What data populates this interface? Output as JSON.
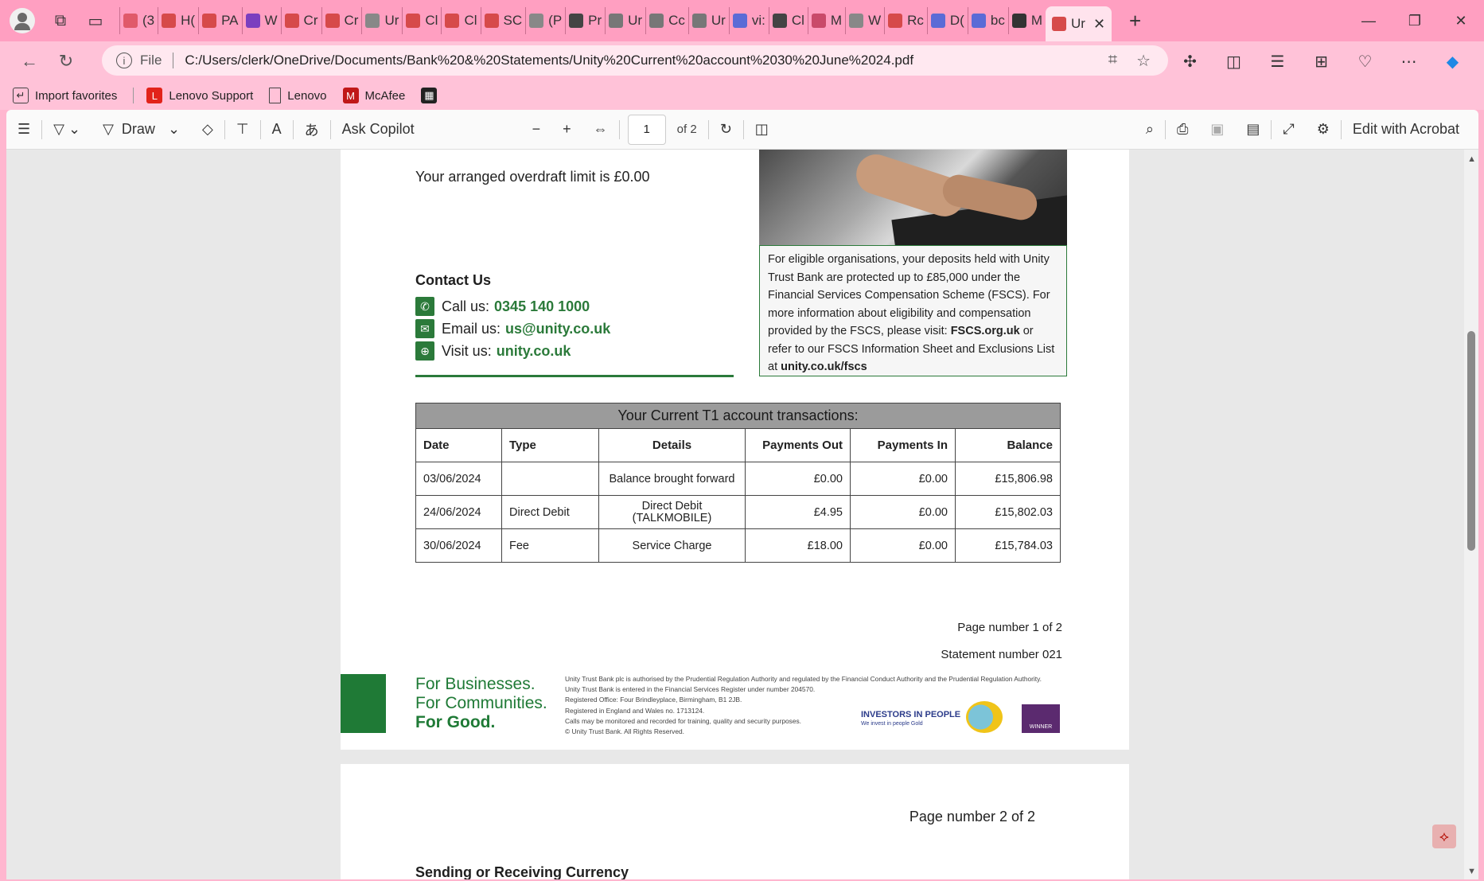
{
  "browser": {
    "tabs": [
      {
        "label": "(3",
        "color": "#e05a6a"
      },
      {
        "label": "H(",
        "color": "#d64a4a"
      },
      {
        "label": "PA",
        "color": "#d64a4a"
      },
      {
        "label": "W",
        "color": "#7b3fbf"
      },
      {
        "label": "Cr",
        "color": "#d64a4a"
      },
      {
        "label": "Cr",
        "color": "#d64a4a"
      },
      {
        "label": "Ur",
        "color": "#888888"
      },
      {
        "label": "Cl",
        "color": "#d64a4a"
      },
      {
        "label": "Cl",
        "color": "#d64a4a"
      },
      {
        "label": "SC",
        "color": "#d64a4a"
      },
      {
        "label": "(P",
        "color": "#888888"
      },
      {
        "label": "Pr",
        "color": "#444444"
      },
      {
        "label": "Ur",
        "color": "#777777"
      },
      {
        "label": "Cc",
        "color": "#777777"
      },
      {
        "label": "Ur",
        "color": "#777777"
      },
      {
        "label": "vi:",
        "color": "#5b6bd6"
      },
      {
        "label": "Cl",
        "color": "#444444"
      },
      {
        "label": "M",
        "color": "#c94a6a"
      },
      {
        "label": "W",
        "color": "#888888"
      },
      {
        "label": "Rc",
        "color": "#d64a4a"
      },
      {
        "label": "D(",
        "color": "#5b6bd6"
      },
      {
        "label": "bc",
        "color": "#5b6bd6"
      },
      {
        "label": "M",
        "color": "#333333"
      }
    ],
    "active_tab": {
      "label": "Ur",
      "close": "✕"
    },
    "new_tab": "+",
    "address": {
      "scheme_label": "File",
      "url": "C:/Users/clerk/OneDrive/Documents/Bank%20&%20Statements/Unity%20Current%20account%2030%20June%2024.pdf"
    },
    "bookmarks": [
      {
        "label": "Import favorites",
        "icon": "import-icon"
      },
      {
        "label": "Lenovo Support",
        "icon": "lenovo-icon",
        "color": "#e2231a"
      },
      {
        "label": "Lenovo",
        "icon": "page-icon"
      },
      {
        "label": "McAfee",
        "icon": "mcafee-icon",
        "color": "#c01818"
      }
    ]
  },
  "pdf_toolbar": {
    "draw_label": "Draw",
    "copilot_label": "Ask Copilot",
    "page_current": "1",
    "page_total": "of 2",
    "edit_label": "Edit with Acrobat"
  },
  "page1": {
    "overdraft": "Your arranged overdraft limit is £0.00",
    "fscs_text_1": "For eligible organisations, your deposits held with Unity Trust Bank are protected up to £85,000 under the Financial Services Compensation Scheme (FSCS). For more information about eligibility and compensation provided by the FSCS, please visit: ",
    "fscs_link_1": "FSCS.org.uk",
    "fscs_text_2": " or refer to our FSCS Information Sheet and Exclusions List at ",
    "fscs_link_2": "unity.co.uk/fscs",
    "contact": {
      "title": "Contact Us",
      "call_label": "Call us:",
      "call_value": "0345 140 1000",
      "email_label": "Email us:",
      "email_value": "us@unity.co.uk",
      "visit_label": "Visit us:",
      "visit_value": "unity.co.uk"
    },
    "table": {
      "caption": "Your Current T1 account transactions:",
      "headers": [
        "Date",
        "Type",
        "Details",
        "Payments Out",
        "Payments In",
        "Balance"
      ],
      "rows": [
        [
          "03/06/2024",
          "",
          "Balance brought forward",
          "£0.00",
          "£0.00",
          "£15,806.98"
        ],
        [
          "24/06/2024",
          "Direct Debit",
          "Direct Debit (TALKMOBILE)",
          "£4.95",
          "£0.00",
          "£15,802.03"
        ],
        [
          "30/06/2024",
          "Fee",
          "Service Charge",
          "£18.00",
          "£0.00",
          "£15,784.03"
        ]
      ]
    },
    "page_number": "Page number 1 of 2",
    "statement_number": "Statement number 021",
    "slogan": [
      "For Businesses.",
      "For Communities.",
      "For Good."
    ],
    "legal": [
      "Unity Trust Bank plc is authorised by the Prudential Regulation Authority and regulated by the Financial Conduct Authority and the Prudential Regulation Authority.",
      "Unity Trust Bank is entered in the Financial Services Register under number 204570.",
      "Registered Office: Four Brindleyplace, Birmingham, B1 2JB.",
      "Registered in England and Wales no. 1713124.",
      "Calls may be monitored and recorded for training, quality and security purposes.",
      "© Unity Trust Bank. All Rights Reserved."
    ],
    "iip": "INVESTORS IN PEOPLE",
    "iip_sub": "We invest in people Gold",
    "macfe": "WINNER"
  },
  "page2": {
    "page_number": "Page number 2 of 2",
    "heading": "Sending or Receiving Currency"
  }
}
